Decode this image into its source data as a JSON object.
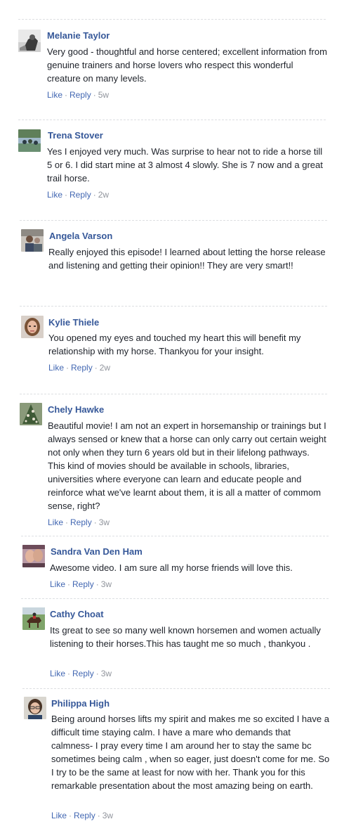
{
  "comments": [
    {
      "author": "Melanie Taylor",
      "text": "Very good - thoughtful and horse centered; excellent information from genuine trainers and horse lovers who respect this wonderful creature on many levels.",
      "like": "Like",
      "reply": "Reply",
      "time": "5w",
      "avatar_icon": "avatar-photo"
    },
    {
      "author": "Trena Stover",
      "text": "Yes I enjoyed very much. Was surprise to hear not to ride a horse till 5 or 6. I did start mine at 3 almost 4 slowly. She is 7 now and a great trail horse.",
      "like": "Like",
      "reply": "Reply",
      "time": "2w",
      "avatar_icon": "avatar-photo"
    },
    {
      "author": "Angela Varson",
      "text": "Really enjoyed this episode! I learned about letting the horse release and listening and getting their opinion!! They are very smart!!",
      "like": "",
      "reply": "",
      "time": "",
      "avatar_icon": "avatar-photo"
    },
    {
      "author": "Kylie Thiele",
      "text": "You opened my eyes and touched my heart this will benefit my relationship with my horse. Thankyou for your insight.",
      "like": "Like",
      "reply": "Reply",
      "time": "2w",
      "avatar_icon": "avatar-photo"
    },
    {
      "author": "Chely Hawke",
      "text": "Beautiful movie! I am not an expert in horsemanship or trainings but I always sensed or knew that a horse can only carry out certain weight not only when they turn 6 years old but in their lifelong pathways. This kind of movies should be available in schools, libraries, universities where everyone can learn and educate people and reinforce what we've learnt about them, it is all a matter of commom sense, right?",
      "like": "Like",
      "reply": "Reply",
      "time": "3w",
      "avatar_icon": "avatar-photo"
    },
    {
      "author": "Sandra Van Den Ham",
      "text": "Awesome video. I am sure all my horse friends will love this.",
      "like": "Like",
      "reply": "Reply",
      "time": "3w",
      "avatar_icon": "avatar-photo"
    },
    {
      "author": "Cathy Choat",
      "text": "Its great to see so many well known horsemen and women actually listening to their horses.This has taught me so much , thankyou .",
      "like": "Like",
      "reply": "Reply",
      "time": "3w",
      "avatar_icon": "avatar-photo"
    },
    {
      "author": "Philippa High",
      "text": "Being around horses lifts my spirit and makes me so excited I have a difficult time staying calm. I have a mare who demands that calmness- I pray every time I am around her to stay the same bc sometimes being calm , when so eager, just doesn't come for me. So I try to be the same at least for now with her. Thank you for this remarkable presentation about the most amazing being on earth.",
      "like": "Like",
      "reply": "Reply",
      "time": "3w",
      "avatar_icon": "avatar-photo"
    }
  ],
  "colors": {
    "name": "#365899",
    "link": "#4267b2",
    "meta": "#90949c",
    "text": "#1d2129",
    "separator": "#dddfe2"
  }
}
